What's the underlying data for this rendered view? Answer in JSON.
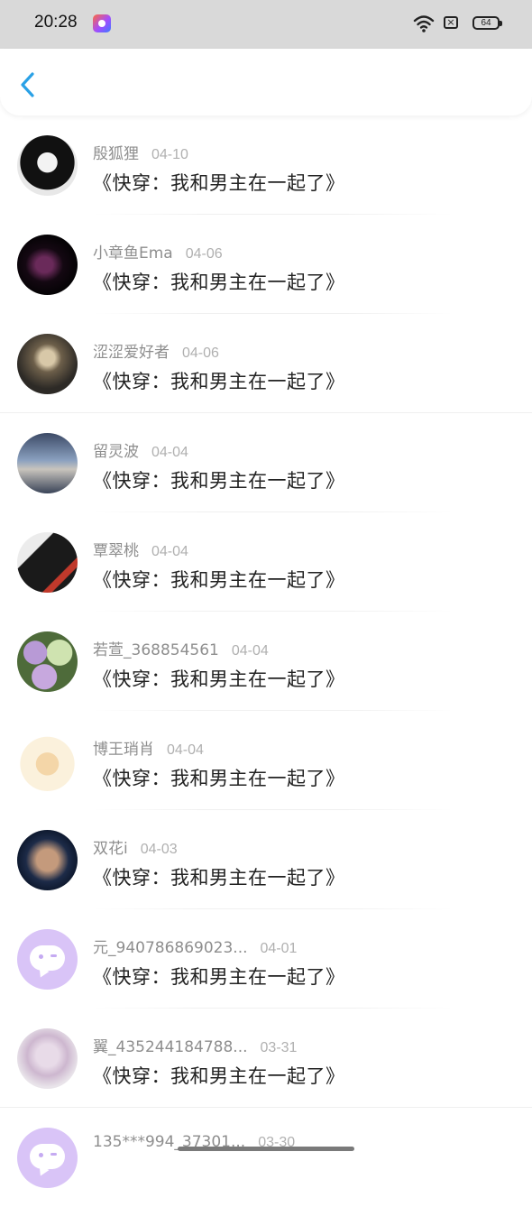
{
  "status_bar": {
    "time": "20:28",
    "battery": "64",
    "icons": [
      "app-notification-icon",
      "wifi-icon",
      "sim-icon",
      "battery-icon"
    ]
  },
  "header": {
    "back_icon": "chevron-left-icon",
    "accent_color": "#2aa1e6"
  },
  "comments": [
    {
      "name": "殷狐狸",
      "date": "04-10",
      "message": "《快穿：我和男主在一起了》"
    },
    {
      "name": "小章鱼Ema",
      "date": "04-06",
      "message": "《快穿：我和男主在一起了》"
    },
    {
      "name": "涩涩爱好者",
      "date": "04-06",
      "message": "《快穿：我和男主在一起了》"
    },
    {
      "name": "留灵波",
      "date": "04-04",
      "message": "《快穿：我和男主在一起了》"
    },
    {
      "name": "覃翠桃",
      "date": "04-04",
      "message": "《快穿：我和男主在一起了》"
    },
    {
      "name": "若萱_368854561",
      "date": "04-04",
      "message": "《快穿：我和男主在一起了》"
    },
    {
      "name": "博王琑肖",
      "date": "04-04",
      "message": "《快穿：我和男主在一起了》"
    },
    {
      "name": "双花i",
      "date": "04-03",
      "message": "《快穿：我和男主在一起了》"
    },
    {
      "name": "元_940786869023...",
      "date": "04-01",
      "message": "《快穿：我和男主在一起了》"
    },
    {
      "name": "翼_435244184788...",
      "date": "03-31",
      "message": "《快穿：我和男主在一起了》"
    },
    {
      "name": "135***994_37301...",
      "date": "03-30",
      "message": ""
    }
  ]
}
